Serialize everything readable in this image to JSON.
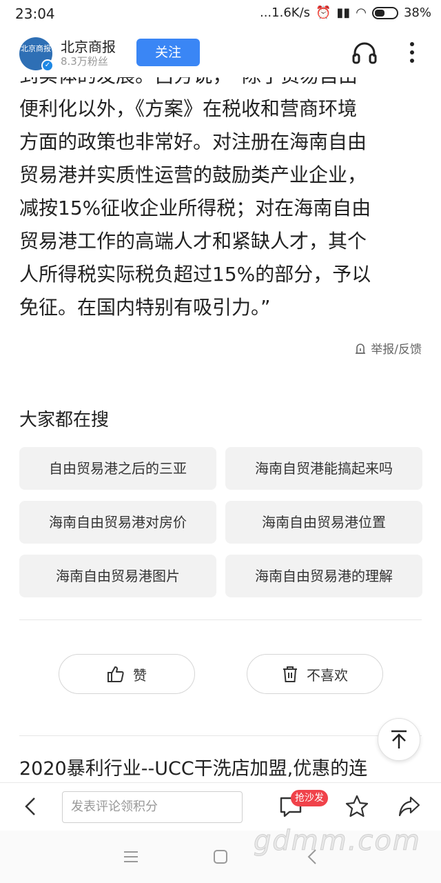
{
  "status_bar": {
    "time": "23:04",
    "network_speed": "...1.6K/s",
    "battery": "38%"
  },
  "header": {
    "avatar_text": "北京商报",
    "account_name": "北京商报",
    "fans": "8.3万粉丝",
    "follow_label": "关注"
  },
  "article": {
    "partial_line": "到实体的发展。”吕芳说，“除了贸易自由",
    "lines": [
      "便利化以外，《方案》在税收和营商环境",
      "方面的政策也非常好。对注册在海南自由",
      "贸易港并实质性运营的鼓励类产业企业，",
      "减按15%征收企业所得税；对在海南自由",
      "贸易港工作的高端人才和紧缺人才，其个",
      "人所得税实际税负超过15%的部分，予以",
      "免征。在国内特别有吸引力。”"
    ],
    "report_label": "举报/反馈"
  },
  "hot_search": {
    "title": "大家都在搜",
    "tags": [
      "自由贸易港之后的三亚",
      "海南自贸港能搞起来吗",
      "海南自由贸易港对房价",
      "海南自由贸易港位置",
      "海南自由贸易港图片",
      "海南自由贸易港的理解"
    ]
  },
  "votes": {
    "like_label": "赞",
    "dislike_label": "不喜欢"
  },
  "ad": {
    "title": "2020暴利行业--UCC干洗店加盟,优惠的连"
  },
  "bottom_bar": {
    "comment_placeholder": "发表评论领积分",
    "sofa_badge": "抢沙发"
  },
  "watermark": "gdmm.com",
  "colors": {
    "accent": "#3a86f5",
    "badge": "#f0424a",
    "tag_bg": "#f2f2f2"
  }
}
